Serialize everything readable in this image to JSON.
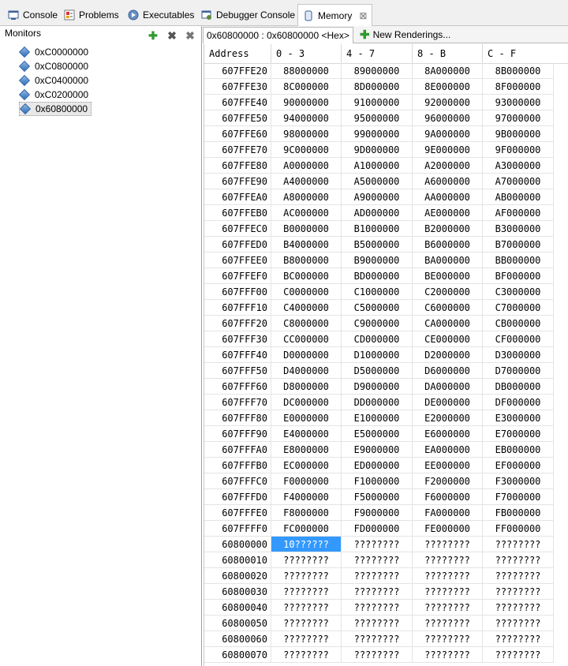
{
  "tabs": [
    {
      "label": "Console",
      "icon": "console-icon",
      "active": false
    },
    {
      "label": "Problems",
      "icon": "problems-icon",
      "active": false
    },
    {
      "label": "Executables",
      "icon": "executables-icon",
      "active": false
    },
    {
      "label": "Debugger Console",
      "icon": "debugger-console-icon",
      "active": false
    },
    {
      "label": "Memory",
      "icon": "memory-icon",
      "active": true,
      "close": "⊠"
    }
  ],
  "monitors": {
    "title": "Monitors",
    "items": [
      "0xC0000000",
      "0xC0800000",
      "0xC0400000",
      "0xC0200000",
      "0x60800000"
    ],
    "selected_index": 4
  },
  "renderings": {
    "active_tab": "0x60800000 : 0x60800000 <Hex>",
    "new_tab": "New Renderings..."
  },
  "memory": {
    "headers": [
      "Address",
      "0 - 3",
      "4 - 7",
      "8 - B",
      "C - F"
    ],
    "selected": {
      "row": 30,
      "col": 0
    },
    "rows": [
      [
        "607FFE20",
        "88000000",
        "89000000",
        "8A000000",
        "8B000000"
      ],
      [
        "607FFE30",
        "8C000000",
        "8D000000",
        "8E000000",
        "8F000000"
      ],
      [
        "607FFE40",
        "90000000",
        "91000000",
        "92000000",
        "93000000"
      ],
      [
        "607FFE50",
        "94000000",
        "95000000",
        "96000000",
        "97000000"
      ],
      [
        "607FFE60",
        "98000000",
        "99000000",
        "9A000000",
        "9B000000"
      ],
      [
        "607FFE70",
        "9C000000",
        "9D000000",
        "9E000000",
        "9F000000"
      ],
      [
        "607FFE80",
        "A0000000",
        "A1000000",
        "A2000000",
        "A3000000"
      ],
      [
        "607FFE90",
        "A4000000",
        "A5000000",
        "A6000000",
        "A7000000"
      ],
      [
        "607FFEA0",
        "A8000000",
        "A9000000",
        "AA000000",
        "AB000000"
      ],
      [
        "607FFEB0",
        "AC000000",
        "AD000000",
        "AE000000",
        "AF000000"
      ],
      [
        "607FFEC0",
        "B0000000",
        "B1000000",
        "B2000000",
        "B3000000"
      ],
      [
        "607FFED0",
        "B4000000",
        "B5000000",
        "B6000000",
        "B7000000"
      ],
      [
        "607FFEE0",
        "B8000000",
        "B9000000",
        "BA000000",
        "BB000000"
      ],
      [
        "607FFEF0",
        "BC000000",
        "BD000000",
        "BE000000",
        "BF000000"
      ],
      [
        "607FFF00",
        "C0000000",
        "C1000000",
        "C2000000",
        "C3000000"
      ],
      [
        "607FFF10",
        "C4000000",
        "C5000000",
        "C6000000",
        "C7000000"
      ],
      [
        "607FFF20",
        "C8000000",
        "C9000000",
        "CA000000",
        "CB000000"
      ],
      [
        "607FFF30",
        "CC000000",
        "CD000000",
        "CE000000",
        "CF000000"
      ],
      [
        "607FFF40",
        "D0000000",
        "D1000000",
        "D2000000",
        "D3000000"
      ],
      [
        "607FFF50",
        "D4000000",
        "D5000000",
        "D6000000",
        "D7000000"
      ],
      [
        "607FFF60",
        "D8000000",
        "D9000000",
        "DA000000",
        "DB000000"
      ],
      [
        "607FFF70",
        "DC000000",
        "DD000000",
        "DE000000",
        "DF000000"
      ],
      [
        "607FFF80",
        "E0000000",
        "E1000000",
        "E2000000",
        "E3000000"
      ],
      [
        "607FFF90",
        "E4000000",
        "E5000000",
        "E6000000",
        "E7000000"
      ],
      [
        "607FFFA0",
        "E8000000",
        "E9000000",
        "EA000000",
        "EB000000"
      ],
      [
        "607FFFB0",
        "EC000000",
        "ED000000",
        "EE000000",
        "EF000000"
      ],
      [
        "607FFFC0",
        "F0000000",
        "F1000000",
        "F2000000",
        "F3000000"
      ],
      [
        "607FFFD0",
        "F4000000",
        "F5000000",
        "F6000000",
        "F7000000"
      ],
      [
        "607FFFE0",
        "F8000000",
        "F9000000",
        "FA000000",
        "FB000000"
      ],
      [
        "607FFFF0",
        "FC000000",
        "FD000000",
        "FE000000",
        "FF000000"
      ],
      [
        "60800000",
        "10??????",
        "????????",
        "????????",
        "????????"
      ],
      [
        "60800010",
        "????????",
        "????????",
        "????????",
        "????????"
      ],
      [
        "60800020",
        "????????",
        "????????",
        "????????",
        "????????"
      ],
      [
        "60800030",
        "????????",
        "????????",
        "????????",
        "????????"
      ],
      [
        "60800040",
        "????????",
        "????????",
        "????????",
        "????????"
      ],
      [
        "60800050",
        "????????",
        "????????",
        "????????",
        "????????"
      ],
      [
        "60800060",
        "????????",
        "????????",
        "????????",
        "????????"
      ],
      [
        "60800070",
        "????????",
        "????????",
        "????????",
        "????????"
      ]
    ]
  },
  "colors": {
    "selection": "#3399ff",
    "add": "#2e9a2e"
  }
}
